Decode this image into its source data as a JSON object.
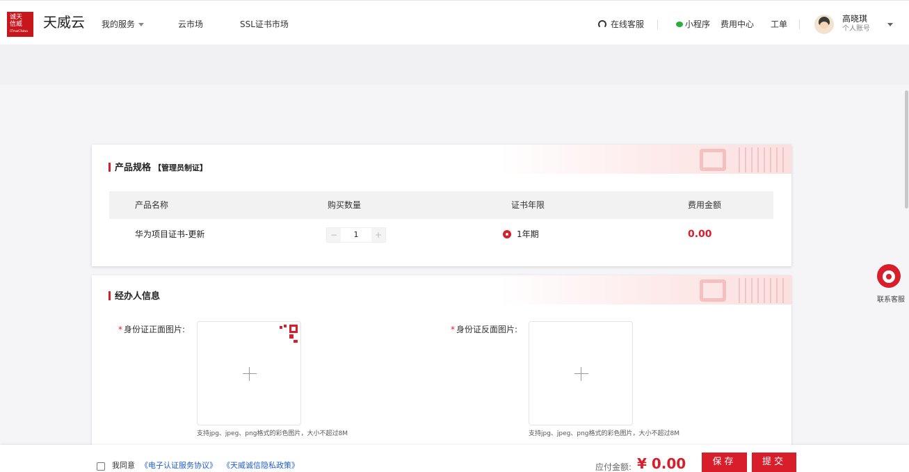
{
  "header": {
    "logo_lines": [
      "诚天",
      "信威"
    ],
    "logo_sub": "iTrusChina",
    "brand": "天威云",
    "nav": {
      "my_services": "我的服务",
      "cloud_market": "云市场",
      "ssl_market": "SSL证书市场"
    },
    "online_service": "在线客服",
    "mini_program": "小程序",
    "billing": "费用中心",
    "ticket": "工单",
    "user_name": "高晓琪",
    "account_type": "个人账号"
  },
  "product_spec": {
    "title": "产品规格",
    "tag": "【管理员制证】",
    "columns": [
      "产品名称",
      "购买数量",
      "证书年限",
      "费用金额"
    ],
    "row": {
      "name": "华为项目证书-更新",
      "minus": "−",
      "quantity": "1",
      "plus": "+",
      "period": "1年期",
      "fee": "0.00"
    }
  },
  "operator": {
    "title": "经办人信息",
    "id_front_label": "身份证正面图片:",
    "id_back_label": "身份证反面图片:",
    "required_mark": "*",
    "upload_hint": "支持jpg、jpeg、png格式的彩色图片，大小不超过8M"
  },
  "footer": {
    "agree_text": "我同意",
    "link_cert_agreement": "《电子认证服务协议》",
    "link_privacy": "《天威诚信隐私政策》",
    "amount_label": "应付金额:",
    "amount": "¥ 0.00",
    "save": "保存",
    "submit": "提交"
  },
  "side": {
    "contact": "联系客服"
  },
  "colors": {
    "accent": "#d81e2a",
    "link": "#1f5fd0",
    "wechat": "#2bad3a"
  }
}
